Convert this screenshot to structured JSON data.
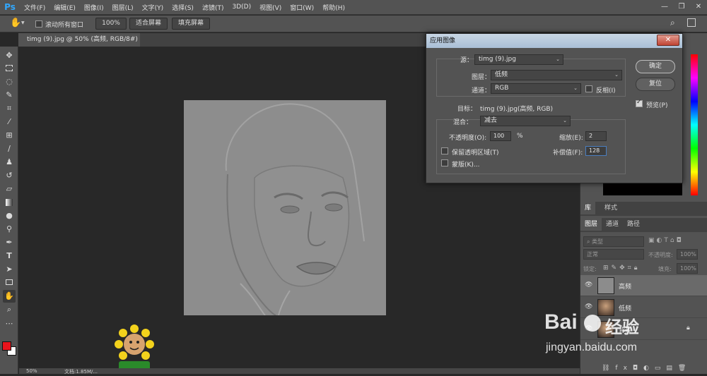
{
  "app": {
    "logo": "Ps"
  },
  "menu": [
    "文件(F)",
    "编辑(E)",
    "图像(I)",
    "图层(L)",
    "文字(Y)",
    "选择(S)",
    "滤镜(T)",
    "3D(D)",
    "视图(V)",
    "窗口(W)",
    "帮助(H)"
  ],
  "window_controls": {
    "minimize": "—",
    "restore": "❐",
    "close": "✕"
  },
  "options_bar": {
    "scroll_all_windows": "滚动所有窗口",
    "zoom_100": "100%",
    "fit_screen": "适合屏幕",
    "fill_screen": "填充屏幕"
  },
  "document": {
    "tab_title": "timg (9).jpg @ 50% (高频, RGB/8#) *",
    "tab_close": "×",
    "zoom": "50%",
    "doc_info": "文档:1.85M/..."
  },
  "dialog": {
    "title": "应用图像",
    "source_label": "源：",
    "source_value": "timg (9).jpg",
    "layer_label": "图层：",
    "layer_value": "低频",
    "channel_label": "通道：",
    "channel_value": "RGB",
    "invert_label": "反相(I)",
    "target_label": "目标：",
    "target_value": "timg (9).jpg(高频, RGB)",
    "blending_label": "混合：",
    "blending_value": "减去",
    "opacity_label": "不透明度(O):",
    "opacity_value": "100",
    "opacity_unit": "%",
    "scale_label": "缩放(E):",
    "scale_value": "2",
    "offset_label": "补偿值(F):",
    "offset_value": "128",
    "preserve_transparency_label": "保留透明区域(T)",
    "mask_label": "蒙版(K)...",
    "ok": "确定",
    "reset": "复位",
    "preview_label": "预览(P)",
    "preview_checked": true
  },
  "panels": {
    "lib_tabs": [
      "库",
      "样式"
    ],
    "layer_tabs": [
      "图层",
      "通道",
      "路径"
    ],
    "kind_placeholder": "类型",
    "blend_mode": "正常",
    "opacity_label": "不透明度:",
    "opacity_value": "100%",
    "lock_label": "锁定:",
    "fill_label": "填充:",
    "fill_value": "100%",
    "layers": [
      {
        "name": "高频",
        "visible": true,
        "selected": true
      },
      {
        "name": "低频",
        "visible": true,
        "selected": false
      },
      {
        "name": "背景",
        "visible": true,
        "selected": false
      }
    ]
  },
  "colors": {
    "foreground": "#e8141c",
    "background": "#ffffff",
    "accent": "#31a8ff",
    "dialog_title_bg": "#b4c8dc",
    "close_red": "#c64a3a"
  },
  "watermark": {
    "brand_left": "Bai",
    "brand_right": "经验",
    "url": "jingyan.baidu.com"
  }
}
